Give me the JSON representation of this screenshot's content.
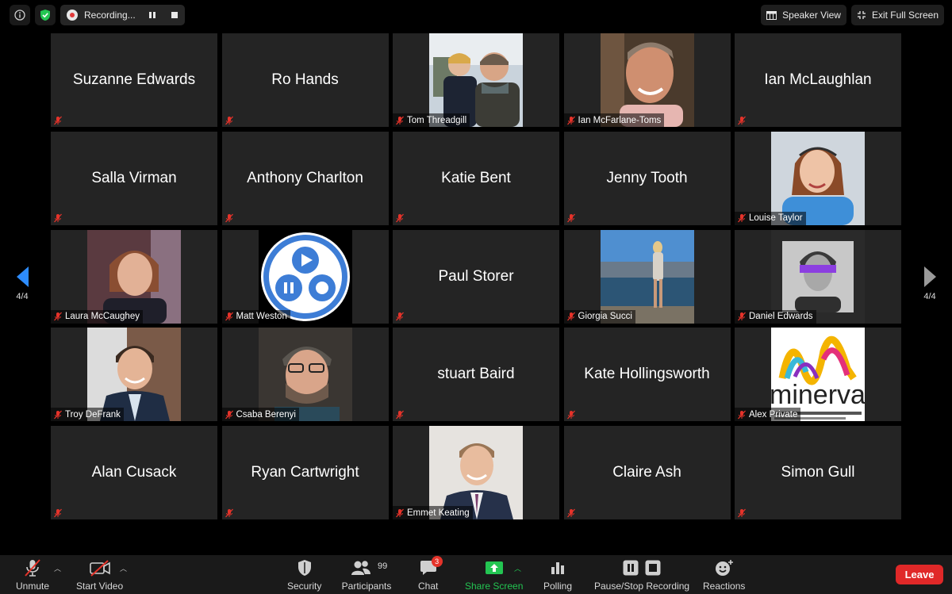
{
  "topbar": {
    "recording_label": "Recording...",
    "speaker_view": "Speaker View",
    "exit_full_screen": "Exit Full Screen"
  },
  "pager": {
    "left": "4/4",
    "right": "4/4"
  },
  "participants": [
    "Suzanne Edwards",
    "Ro Hands",
    "Tom Threadgill",
    "Ian McFarlane-Toms",
    "Ian McLaughlan",
    "Salla Virman",
    "Anthony Charlton",
    "Katie Bent",
    "Jenny Tooth",
    "Louise Taylor",
    "Laura McCaughey",
    "Matt Weston",
    "Paul Storer",
    "Giorgia Succi",
    "Daniel Edwards",
    "Troy DeFrank",
    "Csaba Berenyi",
    "stuart Baird",
    "Kate Hollingsworth",
    "Alex Private",
    "Alan Cusack",
    "Ryan Cartwright",
    "Emmet Keating",
    "Claire Ash",
    "Simon Gull"
  ],
  "logo_text": "minerva",
  "toolbar": {
    "unmute": "Unmute",
    "start_video": "Start Video",
    "security": "Security",
    "participants": "Participants",
    "participants_count": "99",
    "chat": "Chat",
    "chat_badge": "3",
    "share_screen": "Share Screen",
    "polling": "Polling",
    "pause_stop_recording": "Pause/Stop Recording",
    "reactions": "Reactions",
    "leave": "Leave"
  },
  "colors": {
    "accent_green": "#23c552",
    "leave_red": "#e02828",
    "pager_blue": "#2d8cff",
    "mic_off_red": "#e5332a"
  }
}
